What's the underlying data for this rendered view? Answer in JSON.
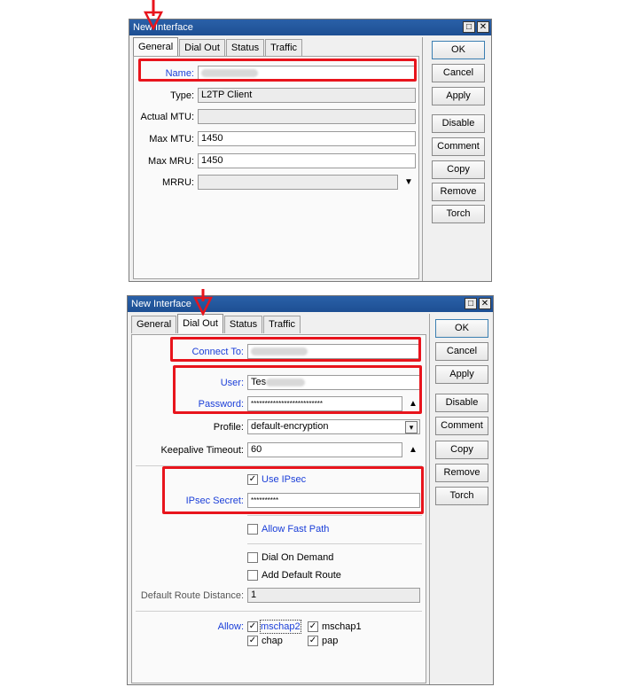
{
  "win1": {
    "title": "New Interface",
    "tabs": [
      "General",
      "Dial Out",
      "Status",
      "Traffic"
    ],
    "fields": {
      "name_label": "Name:",
      "type_label": "Type:",
      "type_value": "L2TP Client",
      "mtu_label": "Actual MTU:",
      "maxmtu_label": "Max MTU:",
      "maxmtu_value": "1450",
      "maxmru_label": "Max MRU:",
      "maxmru_value": "1450",
      "mrru_label": "MRRU:"
    },
    "buttons": [
      "OK",
      "Cancel",
      "Apply",
      "Disable",
      "Comment",
      "Copy",
      "Remove",
      "Torch"
    ]
  },
  "win2": {
    "title": "New Interface",
    "tabs": [
      "General",
      "Dial Out",
      "Status",
      "Traffic"
    ],
    "fields": {
      "connect_label": "Connect To:",
      "user_label": "User:",
      "user_value": "Tes",
      "password_label": "Password:",
      "password_value": "**************************",
      "profile_label": "Profile:",
      "profile_value": "default-encryption",
      "keepalive_label": "Keepalive Timeout:",
      "keepalive_value": "60",
      "use_ipsec_label": "Use IPsec",
      "ipsec_secret_label": "IPsec Secret:",
      "ipsec_secret_value": "**********",
      "fast_path_label": "Allow Fast Path",
      "dial_demand_label": "Dial On Demand",
      "default_route_label": "Add Default Route",
      "route_distance_label": "Default Route Distance:",
      "route_distance_value": "1",
      "allow_label": "Allow:",
      "mschap2_label": "mschap2",
      "mschap1_label": "mschap1",
      "chap_label": "chap",
      "pap_label": "pap"
    },
    "buttons": [
      "OK",
      "Cancel",
      "Apply",
      "Disable",
      "Comment",
      "Copy",
      "Remove",
      "Torch"
    ]
  },
  "colors": {
    "highlight": "#e8141c",
    "titlebar": "#1d4f93",
    "label_blue": "#1a3ed8"
  },
  "icons": [
    "red-down-arrow-icon",
    "minimize-icon",
    "close-icon",
    "dropdown-arrow-icon",
    "checkmark-icon"
  ]
}
